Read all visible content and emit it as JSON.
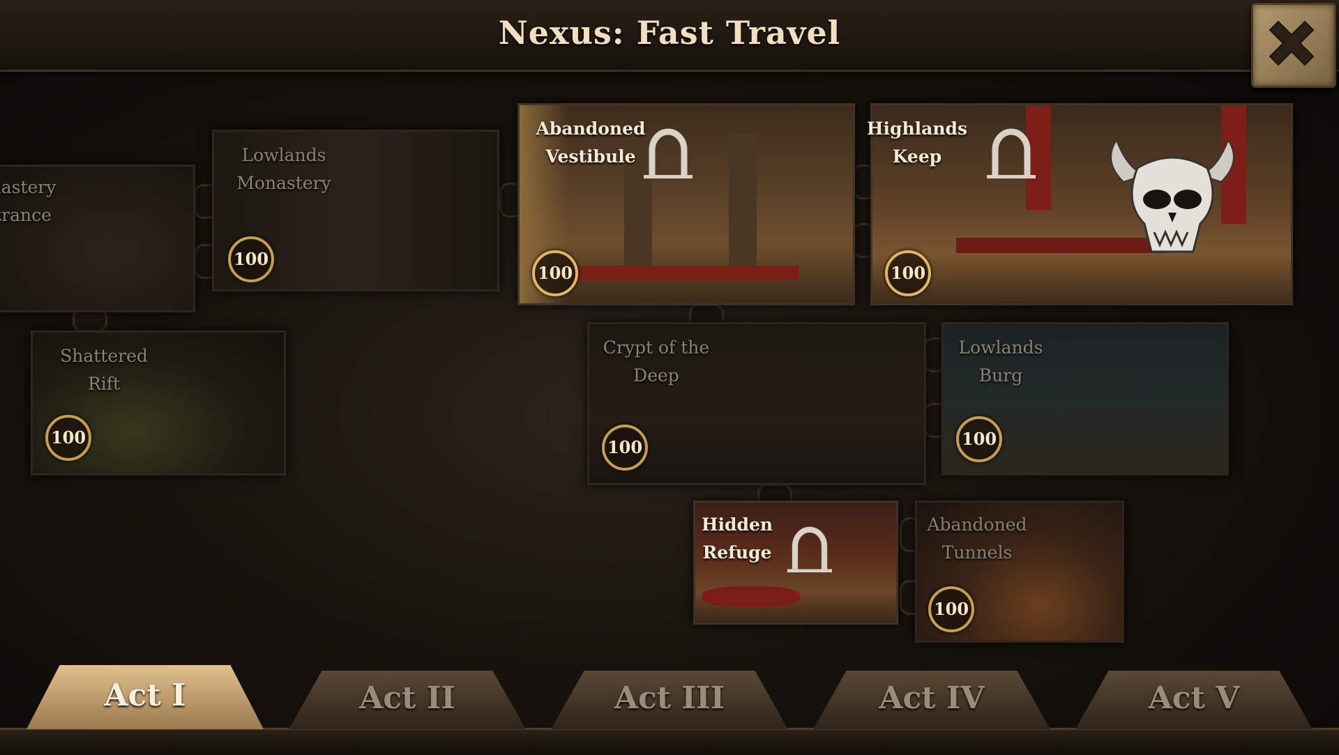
{
  "header": {
    "title": "Nexus: Fast Travel"
  },
  "locations": [
    {
      "name": "Monastery Entrance",
      "line1": "nastery",
      "line2": "trance",
      "cost": "100",
      "unlocked": false
    },
    {
      "name": "Lowlands Monastery",
      "line1": "Lowlands",
      "line2": "Monastery",
      "cost": "100",
      "unlocked": false
    },
    {
      "name": "Abandoned Vestibule",
      "line1": "Abandoned",
      "line2": "Vestibule",
      "cost": "100",
      "unlocked": true,
      "waypoint": true
    },
    {
      "name": "Highlands Keep",
      "line1": "Highlands",
      "line2": "Keep",
      "cost": "100",
      "unlocked": true,
      "waypoint": true,
      "boss": true
    },
    {
      "name": "Shattered Rift",
      "line1": "Shattered",
      "line2": "Rift",
      "cost": "100",
      "unlocked": false
    },
    {
      "name": "Crypt of the Deep",
      "line1": "Crypt of the",
      "line2": "Deep",
      "cost": "100",
      "unlocked": false
    },
    {
      "name": "Lowlands Burg",
      "line1": "Lowlands",
      "line2": "Burg",
      "cost": "100",
      "unlocked": false
    },
    {
      "name": "Hidden Refuge",
      "line1": "Hidden",
      "line2": "Refuge",
      "unlocked": true,
      "waypoint": true
    },
    {
      "name": "Abandoned Tunnels",
      "line1": "Abandoned",
      "line2": "Tunnels",
      "cost": "100",
      "unlocked": false
    }
  ],
  "tabs": [
    {
      "label": "Act I",
      "active": true
    },
    {
      "label": "Act II",
      "active": false
    },
    {
      "label": "Act III",
      "active": false
    },
    {
      "label": "Act IV",
      "active": false
    },
    {
      "label": "Act V",
      "active": false
    }
  ],
  "colors": {
    "accent": "#e2b560",
    "title": "#f3dfc0",
    "frame": "#3e3326"
  }
}
